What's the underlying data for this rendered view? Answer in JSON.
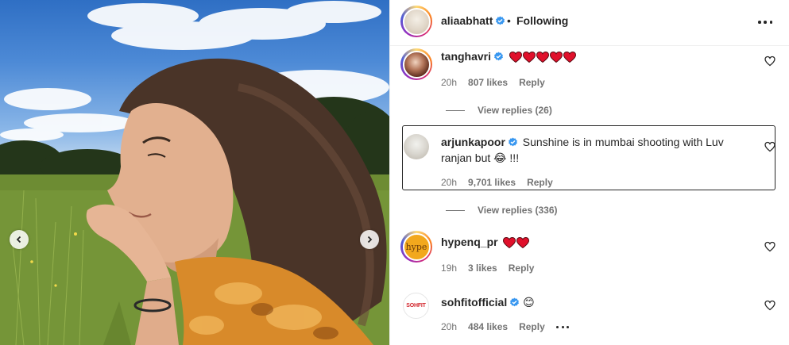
{
  "header": {
    "username": "aliaabhatt",
    "separator": "•",
    "follow_status": "Following"
  },
  "comments": [
    {
      "username": "tanghavri",
      "text": "",
      "hearts": 5,
      "age": "20h",
      "likes": "807 likes",
      "reply": "Reply",
      "view_replies": "View replies (26)"
    },
    {
      "username": "arjunkapoor",
      "text": "Sunshine is in mumbai shooting with Luv",
      "text_line2": "ranjan but",
      "emoji": "😂",
      "text_tail": "!!!",
      "age": "20h",
      "likes": "9,701 likes",
      "reply": "Reply",
      "view_replies": "View replies (336)"
    },
    {
      "username": "hypenq_pr",
      "avatar_text": "hype",
      "hearts": 2,
      "age": "19h",
      "likes": "3 likes",
      "reply": "Reply"
    },
    {
      "username": "sohfitofficial",
      "avatar_text": "SOHFIT",
      "emoji": "😊",
      "age": "20h",
      "likes": "484 likes",
      "reply": "Reply"
    }
  ],
  "icons": {
    "verified": "verified-badge-icon",
    "heart": "heart-outline-icon",
    "more": "more-options-icon",
    "prev": "chevron-left-icon",
    "next": "chevron-right-icon"
  },
  "colors": {
    "verified": "#3897f0",
    "heart_emoji": "#e0102b",
    "meta_text": "#737373"
  }
}
